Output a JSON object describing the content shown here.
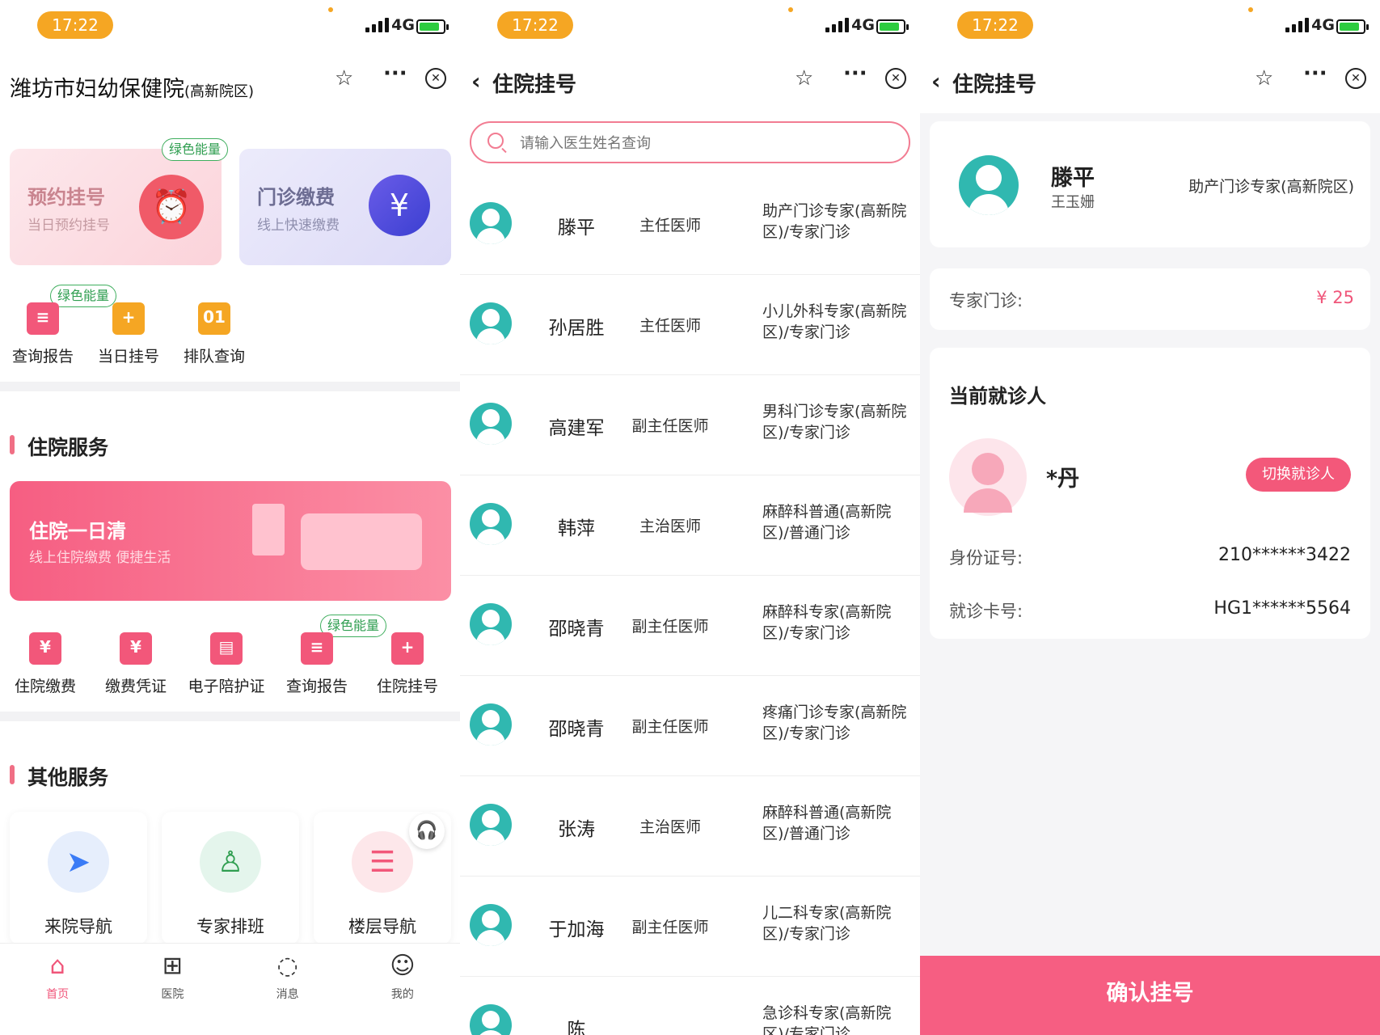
{
  "status": {
    "time": "17:22",
    "network": "4G"
  },
  "panel1": {
    "title": "潍坊市妇幼保健院",
    "title_small": "(高新院区)",
    "cards": [
      {
        "title": "预约挂号",
        "subtitle": "当日预约挂号",
        "tag": "绿色能量"
      },
      {
        "title": "门诊缴费",
        "subtitle": "线上快速缴费"
      }
    ],
    "quick_tag": "绿色能量",
    "quick": [
      {
        "label": "查询报告",
        "color": "#f2577a",
        "glyph": "≡"
      },
      {
        "label": "当日挂号",
        "color": "#f5a623",
        "glyph": "+"
      },
      {
        "label": "排队查询",
        "color": "#f5a623",
        "glyph": "01"
      }
    ],
    "section1": "住院服务",
    "banner": {
      "title": "住院一日清",
      "subtitle": "线上住院缴费 便捷生活"
    },
    "inpatient_tag": "绿色能量",
    "inpatient": [
      {
        "label": "住院缴费",
        "color": "#f2577a",
        "glyph": "¥"
      },
      {
        "label": "缴费凭证",
        "color": "#f2577a",
        "glyph": "¥"
      },
      {
        "label": "电子陪护证",
        "color": "#f2577a",
        "glyph": "▤"
      },
      {
        "label": "查询报告",
        "color": "#f2577a",
        "glyph": "≡"
      },
      {
        "label": "住院挂号",
        "color": "#f2577a",
        "glyph": "+"
      }
    ],
    "section2": "其他服务",
    "services": [
      {
        "label": "来院导航",
        "color": "#e6eefc",
        "glyph": "➤",
        "glyph_color": "#3a7bf6"
      },
      {
        "label": "专家排班",
        "color": "#e4f5ec",
        "glyph": "♙",
        "glyph_color": "#2f9e50"
      },
      {
        "label": "楼层导航",
        "color": "#fde7ea",
        "glyph": "☰",
        "glyph_color": "#f2577a"
      }
    ],
    "tabs": [
      {
        "label": "首页",
        "glyph": "⌂"
      },
      {
        "label": "医院",
        "glyph": "⊞"
      },
      {
        "label": "消息",
        "glyph": "◌"
      },
      {
        "label": "我的",
        "glyph": "☺"
      }
    ]
  },
  "panel2": {
    "title": "住院挂号",
    "search_placeholder": "请输入医生姓名查询",
    "doctors": [
      {
        "name": "滕平",
        "title": "主任医师",
        "dept": "助产门诊专家(高新院区)/专家门诊"
      },
      {
        "name": "孙居胜",
        "title": "主任医师",
        "dept": "小儿外科专家(高新院区)/专家门诊"
      },
      {
        "name": "高建军",
        "title": "副主任医师",
        "dept": "男科门诊专家(高新院区)/专家门诊"
      },
      {
        "name": "韩萍",
        "title": "主治医师",
        "dept": "麻醉科普通(高新院区)/普通门诊"
      },
      {
        "name": "邵晓青",
        "title": "副主任医师",
        "dept": "麻醉科专家(高新院区)/专家门诊"
      },
      {
        "name": "邵晓青",
        "title": "副主任医师",
        "dept": "疼痛门诊专家(高新院区)/专家门诊"
      },
      {
        "name": "张涛",
        "title": "主治医师",
        "dept": "麻醉科普通(高新院区)/普通门诊"
      },
      {
        "name": "于加海",
        "title": "副主任医师",
        "dept": "儿二科专家(高新院区)/专家门诊"
      },
      {
        "name": "陈",
        "title": "",
        "dept": "急诊科专家(高新院区)/专家门诊"
      }
    ]
  },
  "panel3": {
    "title": "住院挂号",
    "doctor_name": "滕平",
    "doctor_sub": "王玉姗",
    "doctor_dept": "助产门诊专家(高新院区)",
    "fee_label": "专家门诊:",
    "fee_value": "¥ 25",
    "current_label": "当前就诊人",
    "patient_name": "*丹",
    "switch_label": "切换就诊人",
    "id_label": "身份证号:",
    "id_value": "210******3422",
    "card_label": "就诊卡号:",
    "card_value": "HG1******5564",
    "confirm": "确认挂号"
  }
}
